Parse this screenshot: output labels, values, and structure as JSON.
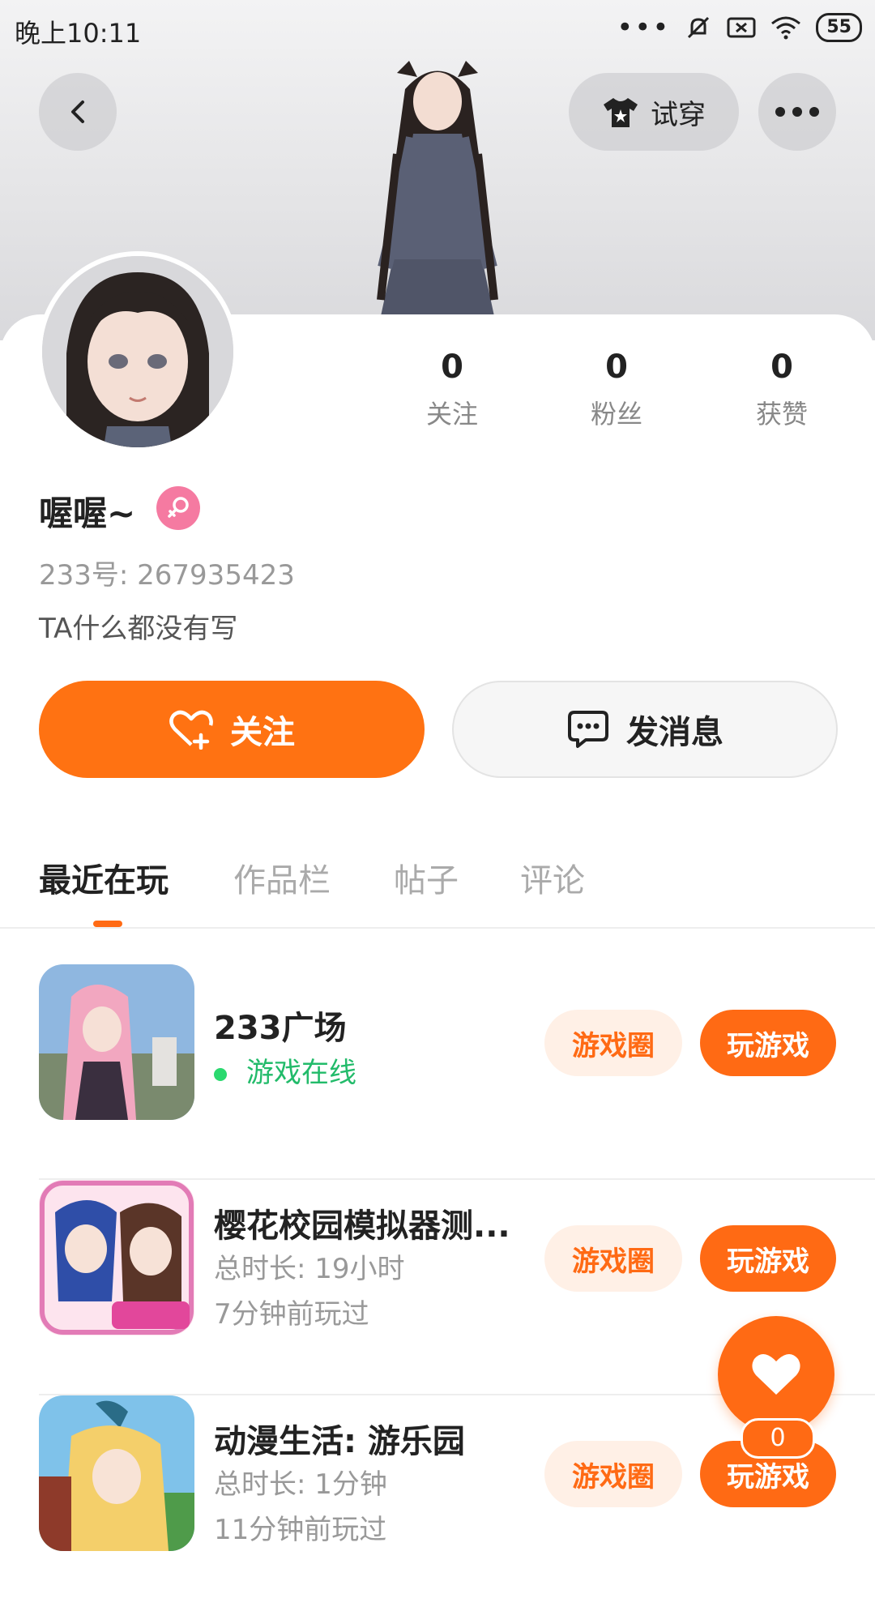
{
  "status_bar": {
    "time": "晚上10:11",
    "dots": "•••",
    "battery": "55"
  },
  "header": {
    "tryon_label": "试穿"
  },
  "profile": {
    "username": "喔喔~",
    "gender": "female",
    "uid": "233号: 267935423",
    "bio": "TA什么都没有写",
    "stats": [
      {
        "value": "0",
        "label": "关注"
      },
      {
        "value": "0",
        "label": "粉丝"
      },
      {
        "value": "0",
        "label": "获赞"
      }
    ]
  },
  "actions": {
    "follow_label": "关注",
    "message_label": "发消息"
  },
  "tabs": [
    "最近在玩",
    "作品栏",
    "帖子",
    "评论"
  ],
  "games": [
    {
      "title": "233广场",
      "status": "游戏在线",
      "circle": "游戏圈",
      "play": "玩游戏"
    },
    {
      "title": "樱花校园模拟器测...",
      "duration": "总时长: 19小时",
      "last_played": "7分钟前玩过",
      "circle": "游戏圈",
      "play": "玩游戏"
    },
    {
      "title": "动漫生活: 游乐园",
      "duration": "总时长: 1分钟",
      "last_played": "11分钟前玩过",
      "circle": "游戏圈",
      "play": "玩游戏"
    }
  ],
  "like_fab": {
    "count": "0"
  },
  "colors": {
    "accent": "#ff6a14",
    "online": "#22bb6a",
    "gender_female": "#f57aa1"
  }
}
